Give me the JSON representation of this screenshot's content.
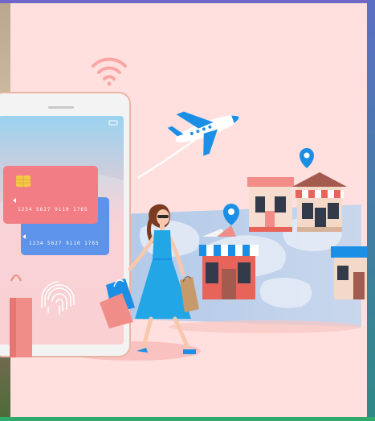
{
  "cards": {
    "front_number": "1234  5627  9110  1765",
    "back_number": "1234  5627  9110  1765"
  },
  "colors": {
    "background": "#ffe0de",
    "phone_screen_top": "#9ad3ef",
    "phone_screen_bottom": "#f9c6c9",
    "card_red": "#f27d84",
    "card_blue": "#5d93e9",
    "dress_blue": "#22a6e6",
    "accent_blue": "#1b8fe6",
    "shop_red": "#e8645b"
  },
  "icons": [
    "wifi-icon",
    "location-pin-icon",
    "fingerprint-icon",
    "airplane-icon",
    "shopping-bag-icon"
  ]
}
